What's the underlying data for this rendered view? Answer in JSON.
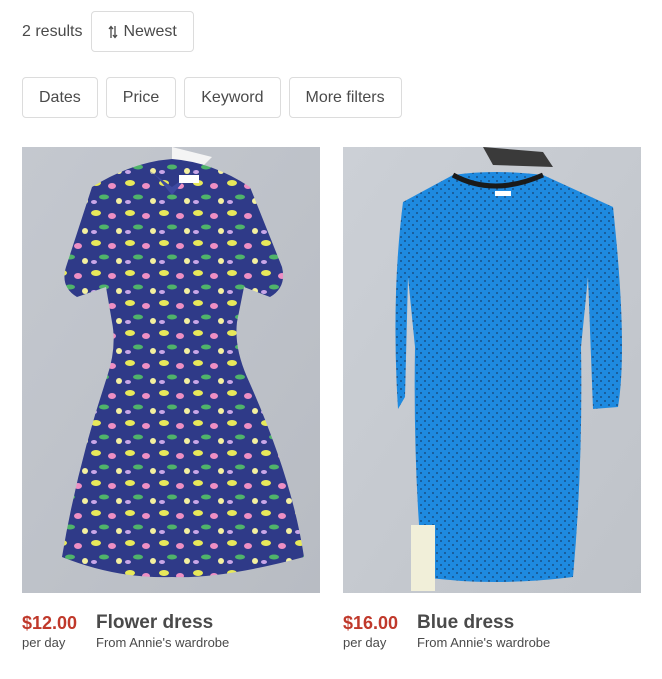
{
  "header": {
    "results": "2 results",
    "sort_label": "Newest",
    "sort_icon": "sort-arrows-icon"
  },
  "filters": [
    "Dates",
    "Price",
    "Keyword",
    "More filters"
  ],
  "listings": [
    {
      "price": "$12.00",
      "period": "per day",
      "title": "Flower dress",
      "owner": "From Annie's wardrobe",
      "dress_color": "#2f3a88"
    },
    {
      "price": "$16.00",
      "period": "per day",
      "title": "Blue dress",
      "owner": "From Annie's wardrobe",
      "dress_color": "#1e8ae0"
    }
  ]
}
